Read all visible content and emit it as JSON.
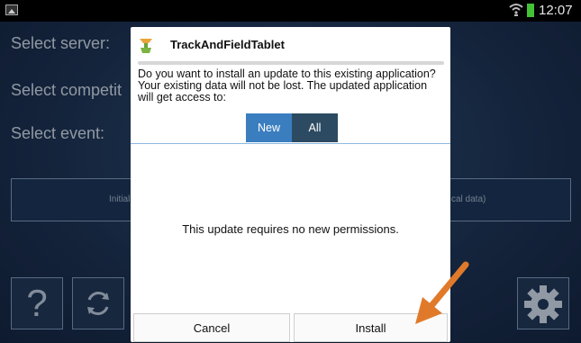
{
  "status_bar": {
    "time": "12:07"
  },
  "background_app": {
    "labels": [
      "Select server:",
      "Select competit",
      "Select event:"
    ],
    "wide_button_left": "Initializ",
    "wide_button_right": "cal data)",
    "help_button": "?"
  },
  "dialog": {
    "title": "TrackAndFieldTablet",
    "message": "Do you want to install an update to this existing application? Your existing data will not be lost. The updated application will get access to:",
    "tabs": [
      "New",
      "All"
    ],
    "selected_tab": "New",
    "permissions_text": "This update requires no new permissions.",
    "cancel_label": "Cancel",
    "install_label": "Install"
  },
  "colors": {
    "accent": "#3a7ec0",
    "arrow": "#e07a2a",
    "battery": "#44c236"
  }
}
